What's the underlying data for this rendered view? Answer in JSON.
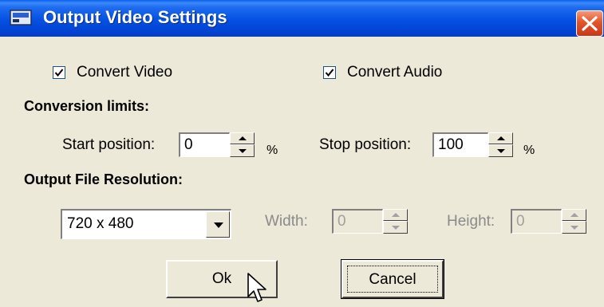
{
  "window": {
    "title": "Output Video Settings",
    "icon": "video-settings-icon",
    "close": "close-icon"
  },
  "options": {
    "convert_video_label": "Convert Video",
    "convert_video_checked": true,
    "convert_audio_label": "Convert Audio",
    "convert_audio_checked": true
  },
  "limits": {
    "heading": "Conversion limits:",
    "start_label": "Start position:",
    "start_value": "0",
    "start_unit": "%",
    "stop_label": "Stop position:",
    "stop_value": "100",
    "stop_unit": "%"
  },
  "resolution": {
    "heading": "Output File Resolution:",
    "selected": "720 x 480",
    "width_label": "Width:",
    "width_value": "0",
    "height_label": "Height:",
    "height_value": "0"
  },
  "buttons": {
    "ok_label": "Ok",
    "cancel_label": "Cancel"
  },
  "colors": {
    "titlebar": "#0450e2",
    "dialog_bg": "#ece9d8",
    "close_button": "#e2542a"
  }
}
